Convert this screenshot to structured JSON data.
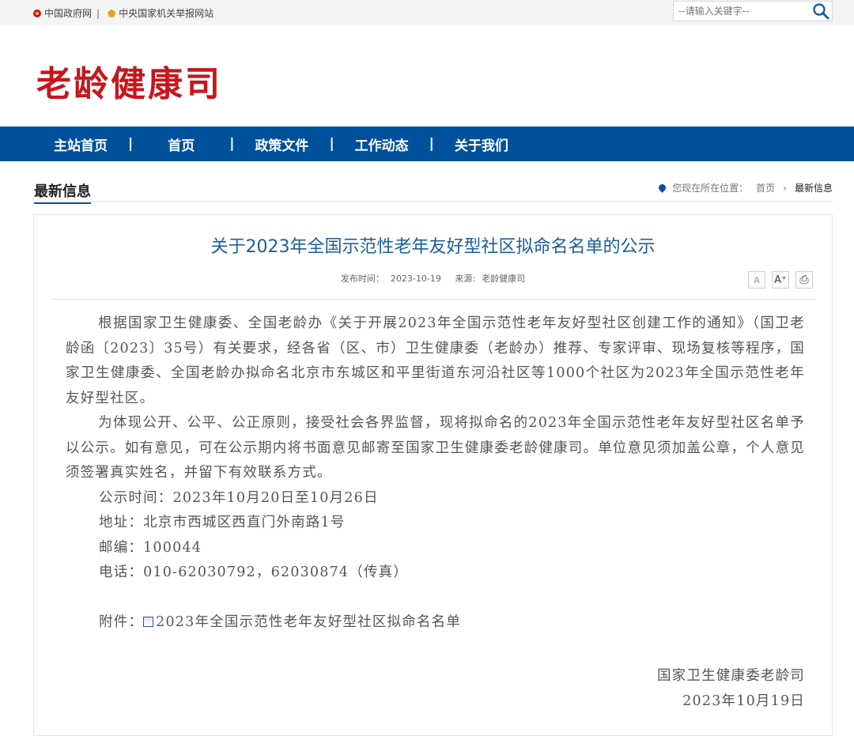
{
  "topbar": {
    "link1": "中国政府网",
    "sep": "|",
    "link2": "中央国家机关举报网站",
    "search_placeholder": "--请输入关键字--"
  },
  "header": {
    "site_title": "老龄健康司"
  },
  "nav": {
    "items": [
      "主站首页",
      "首页",
      "政策文件",
      "工作动态",
      "关于我们"
    ],
    "sep": "|"
  },
  "section": {
    "title": "最新信息",
    "crumb_label": "您现在所在位置：",
    "crumb_home": "首页",
    "crumb_chev": "›",
    "crumb_current": "最新信息"
  },
  "article": {
    "title": "关于2023年全国示范性老年友好型社区拟命名名单的公示",
    "meta_date_label": "发布时间：",
    "meta_date": "2023-10-19",
    "meta_source_label": "来源:",
    "meta_source": "老龄健康司",
    "tools": {
      "font_small": "A",
      "font_large": "A⁺",
      "print": "⎙"
    },
    "para1": "根据国家卫生健康委、全国老龄办《关于开展2023年全国示范性老年友好型社区创建工作的通知》（国卫老龄函〔2023〕35号）有关要求，经各省（区、市）卫生健康委（老龄办）推荐、专家评审、现场复核等程序，国家卫生健康委、全国老龄办拟命名北京市东城区和平里街道东河沿社区等1000个社区为2023年全国示范性老年友好型社区。",
    "para2": "为体现公开、公平、公正原则，接受社会各界监督，现将拟命名的2023年全国示范性老年友好型社区名单予以公示。如有意见，可在公示期内将书面意见邮寄至国家卫生健康委老龄健康司。单位意见须加盖公章，个人意见须签署真实姓名，并留下有效联系方式。",
    "period": "公示时间：2023年10月20日至10月26日",
    "address": "地址：北京市西城区西直门外南路1号",
    "postcode": "邮编：100044",
    "phone": "电话：010-62030792，62030874（传真）",
    "attach_label": "附件：",
    "attach_name": "2023年全国示范性老年友好型社区拟命名名单",
    "sign_org": "国家卫生健康委老龄司",
    "sign_date": "2023年10月19日"
  }
}
